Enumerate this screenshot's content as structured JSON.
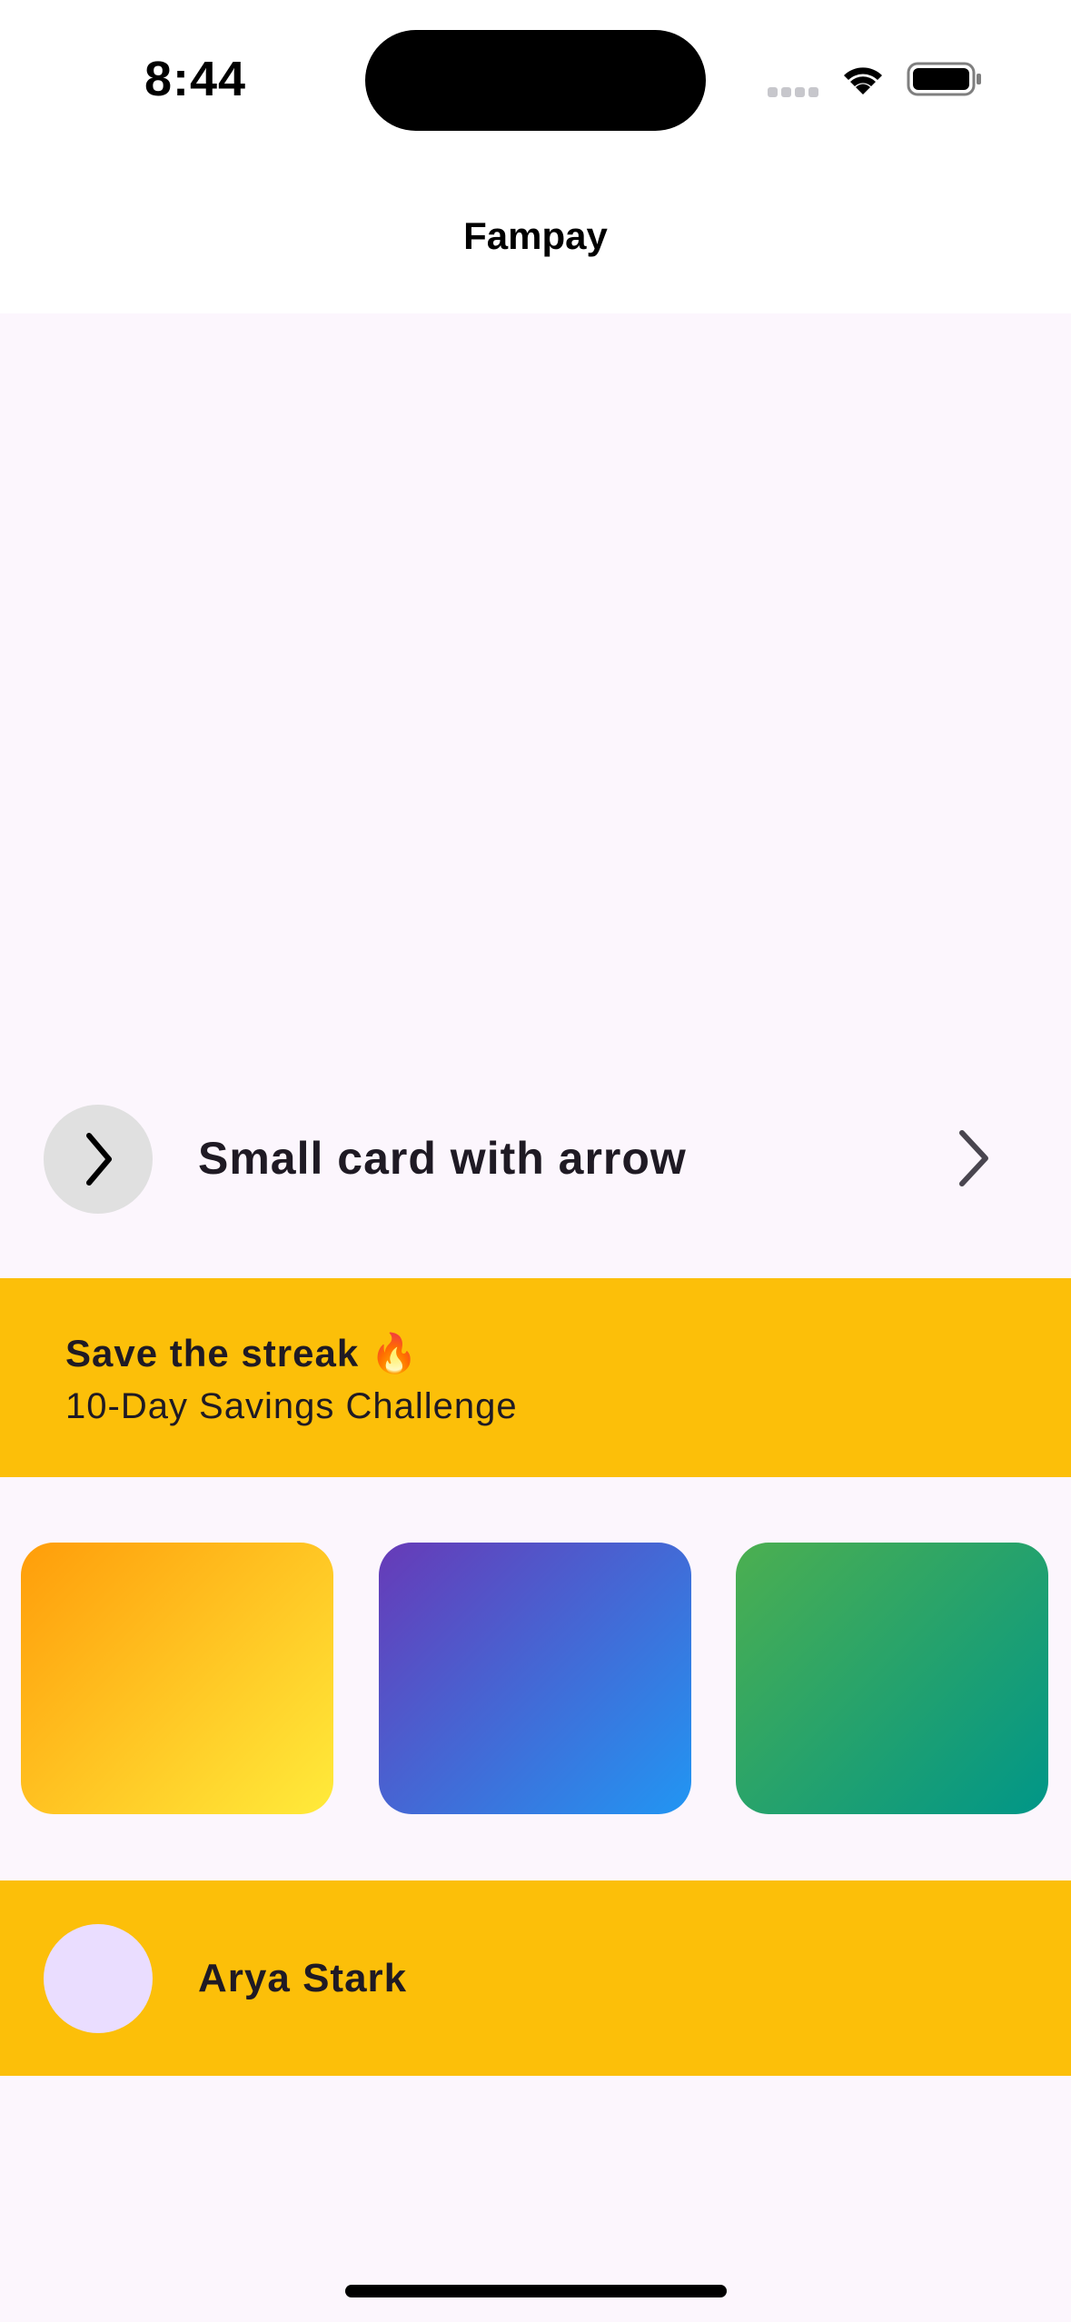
{
  "status_bar": {
    "time": "8:44"
  },
  "app_bar": {
    "title": "Fampay"
  },
  "arrow_card": {
    "title": "Small card with arrow",
    "leading_icon": "chevron-right-icon",
    "trailing_icon": "chevron-right-icon"
  },
  "streak_banner": {
    "title": "Save the streak 🔥",
    "subtitle": "10-Day Savings Challenge",
    "color": "#FCBF09"
  },
  "gradient_cards": [
    {
      "from": "#FF9D0A",
      "to": "#FFEB3B"
    },
    {
      "from": "#673AB7",
      "to": "#2196F3"
    },
    {
      "from": "#4CAF50",
      "to": "#009688"
    }
  ],
  "profile_banner": {
    "name": "Arya Stark",
    "color": "#FCBF09",
    "avatar_color": "#EADDFF"
  },
  "colors": {
    "background": "#FCF6FD",
    "header": "#FFFFFF"
  }
}
